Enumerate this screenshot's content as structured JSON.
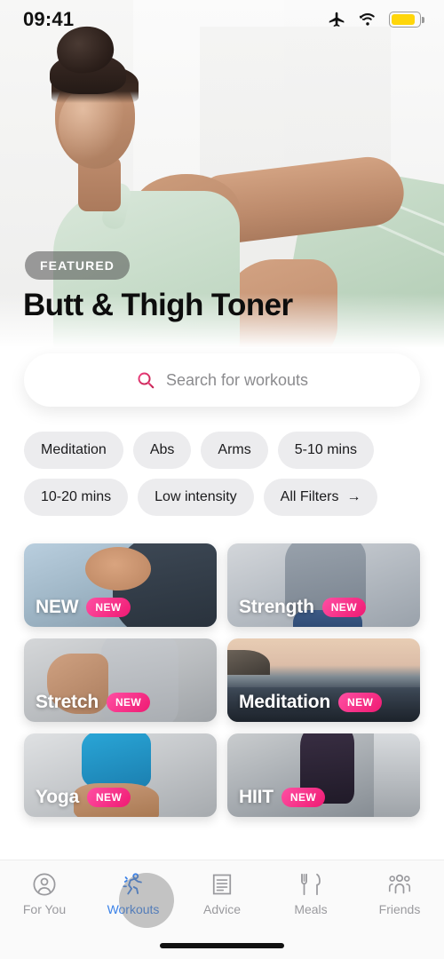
{
  "status_bar": {
    "time": "09:41",
    "icons": [
      "airplane-mode-icon",
      "wifi-icon",
      "battery-icon"
    ],
    "battery_color": "#ffd60a",
    "battery_level": 85
  },
  "hero": {
    "badge": "FEATURED",
    "title": "Butt & Thigh Toner",
    "image_alt": "woman in mint green activewear stretching"
  },
  "search": {
    "placeholder": "Search for workouts",
    "icon": "search-icon",
    "icon_color": "#d6215c"
  },
  "filters": {
    "chips": [
      {
        "label": "Meditation"
      },
      {
        "label": "Abs"
      },
      {
        "label": "Arms"
      },
      {
        "label": "5-10 mins"
      },
      {
        "label": "10-20 mins"
      },
      {
        "label": "Low intensity"
      },
      {
        "label": "All Filters",
        "arrow": "→"
      }
    ]
  },
  "categories": {
    "badge_label": "NEW",
    "badge_color": "#ef1a72",
    "cards": [
      {
        "title": "NEW",
        "badge": "NEW",
        "art": "img-new"
      },
      {
        "title": "Strength",
        "badge": "NEW",
        "art": "img-strength"
      },
      {
        "title": "Stretch",
        "badge": "NEW",
        "art": "img-stretch"
      },
      {
        "title": "Meditation",
        "badge": "NEW",
        "art": "img-meditation"
      },
      {
        "title": "Yoga",
        "badge": "NEW",
        "art": "img-yoga"
      },
      {
        "title": "HIIT",
        "badge": "NEW",
        "art": "img-hiit"
      }
    ]
  },
  "tabbar": {
    "active_color": "#3b82e8",
    "inactive_color": "#9a9a9e",
    "items": [
      {
        "label": "For You",
        "icon": "person-circle-icon",
        "active": false
      },
      {
        "label": "Workouts",
        "icon": "running-figure-icon",
        "active": true
      },
      {
        "label": "Advice",
        "icon": "document-icon",
        "active": false
      },
      {
        "label": "Meals",
        "icon": "fork-knife-icon",
        "active": false
      },
      {
        "label": "Friends",
        "icon": "people-group-icon",
        "active": false
      }
    ]
  }
}
